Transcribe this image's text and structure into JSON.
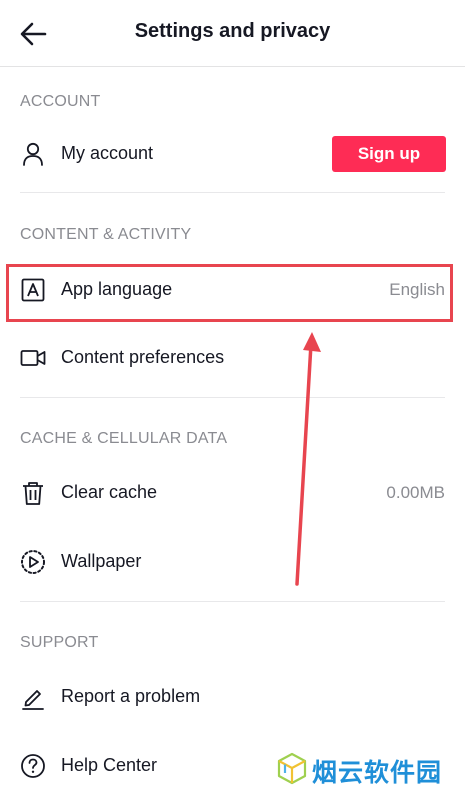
{
  "header": {
    "title": "Settings and privacy"
  },
  "sections": {
    "account": {
      "title": "ACCOUNT",
      "my_account": {
        "label": "My account",
        "button": "Sign up"
      }
    },
    "content": {
      "title": "CONTENT & ACTIVITY",
      "app_language": {
        "label": "App language",
        "value": "English"
      },
      "content_preferences": {
        "label": "Content preferences"
      }
    },
    "cache": {
      "title": "CACHE & CELLULAR DATA",
      "clear_cache": {
        "label": "Clear cache",
        "value": "0.00MB"
      },
      "wallpaper": {
        "label": "Wallpaper"
      }
    },
    "support": {
      "title": "SUPPORT",
      "report_problem": {
        "label": "Report a problem"
      },
      "help_center": {
        "label": "Help Center"
      }
    }
  },
  "annotation": {
    "highlight_color": "#e8454f"
  },
  "watermark": {
    "text": "烟云软件园"
  },
  "colors": {
    "accent": "#fe2c55",
    "text_primary": "#161823",
    "text_secondary": "#8a8b91"
  }
}
